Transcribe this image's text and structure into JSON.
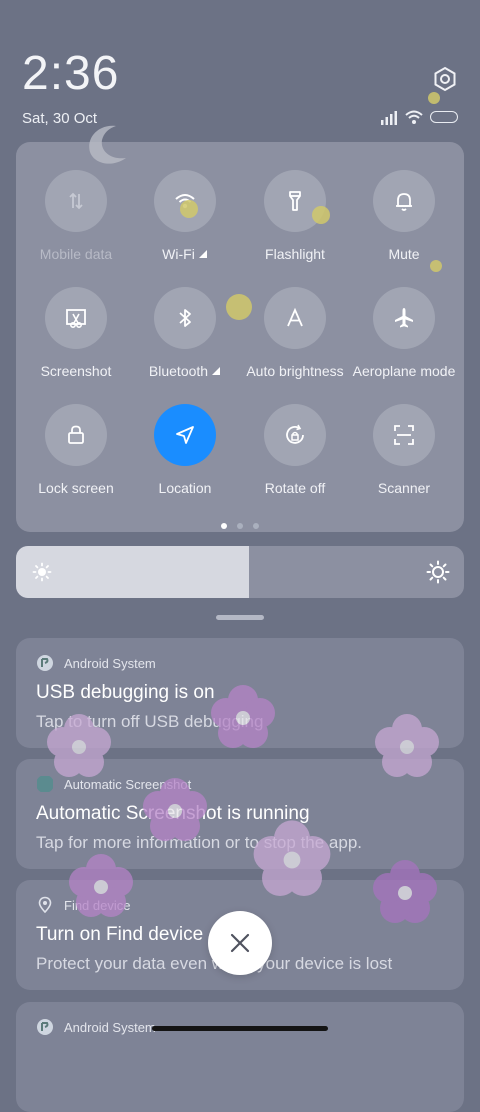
{
  "status_bar": {
    "time": "2:36",
    "date": "Sat, 30 Oct"
  },
  "quick_settings": {
    "tiles": [
      {
        "label": "Mobile data",
        "icon": "mobile-data-icon",
        "active": false,
        "enabled": false
      },
      {
        "label": "Wi-Fi",
        "icon": "wifi-icon",
        "active": false,
        "has_arrow": true
      },
      {
        "label": "Flashlight",
        "icon": "flashlight-icon",
        "active": false
      },
      {
        "label": "Mute",
        "icon": "bell-icon",
        "active": false
      },
      {
        "label": "Screenshot",
        "icon": "screenshot-icon",
        "active": false
      },
      {
        "label": "Bluetooth",
        "icon": "bluetooth-icon",
        "active": false,
        "has_arrow": true
      },
      {
        "label": "Auto brightness",
        "icon": "auto-brightness-icon",
        "active": false
      },
      {
        "label": "Aeroplane mode",
        "icon": "airplane-icon",
        "active": false
      },
      {
        "label": "Lock screen",
        "icon": "lock-icon",
        "active": false
      },
      {
        "label": "Location",
        "icon": "location-icon",
        "active": true
      },
      {
        "label": "Rotate off",
        "icon": "rotate-lock-icon",
        "active": false
      },
      {
        "label": "Scanner",
        "icon": "scanner-icon",
        "active": false
      }
    ],
    "page_count": 3,
    "current_page": 1
  },
  "brightness": {
    "level": 0.52
  },
  "notifications": [
    {
      "app": "Android System",
      "title": "USB debugging is on",
      "body": "Tap to turn off USB debugging"
    },
    {
      "app": "Automatic Screenshot",
      "title": "Automatic Screenshot is running",
      "body": "Tap for more information or to stop the app."
    },
    {
      "app": "Find device",
      "title": "Turn on Find device",
      "body": "Protect your data even when your device is lost"
    },
    {
      "app": "Android System",
      "title": "",
      "body": ""
    }
  ],
  "colors": {
    "background": "#6c7285",
    "panel": "#8c90a1",
    "accent": "#1a8dff"
  }
}
